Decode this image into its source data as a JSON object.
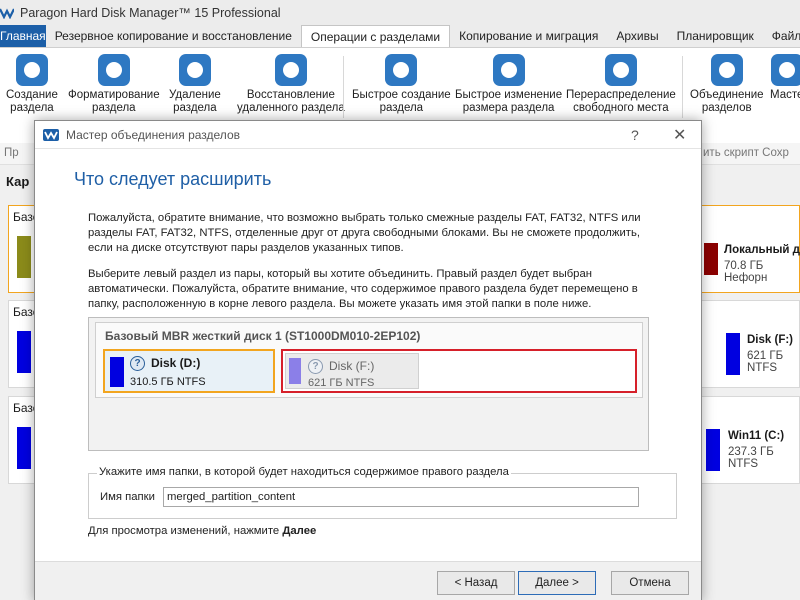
{
  "app": {
    "title": "Paragon Hard Disk Manager™ 15 Professional"
  },
  "tabs": [
    {
      "label": "Главная"
    },
    {
      "label": "Резервное копирование и восстановление"
    },
    {
      "label": "Операции с разделами"
    },
    {
      "label": "Копирование и миграция"
    },
    {
      "label": "Архивы"
    },
    {
      "label": "Планировщик"
    },
    {
      "label": "Файловы"
    }
  ],
  "ribbon": {
    "buttons": [
      {
        "line1": "Создание",
        "line2": "раздела",
        "icon": "create-partition-icon"
      },
      {
        "line1": "Форматирование",
        "line2": "раздела",
        "icon": "format-partition-icon"
      },
      {
        "line1": "Удаление",
        "line2": "раздела",
        "icon": "delete-partition-icon"
      },
      {
        "line1": "Восстановление",
        "line2": "удаленного раздела",
        "icon": "recover-partition-icon"
      },
      {
        "line1": "Быстрое создание",
        "line2": "раздела",
        "icon": "quick-create-icon"
      },
      {
        "line1": "Быстрое изменение",
        "line2": "размера раздела",
        "icon": "quick-resize-icon"
      },
      {
        "line1": "Перераспределение",
        "line2": "свободного места",
        "icon": "redistribute-icon"
      },
      {
        "line1": "Объединение",
        "line2": "разделов",
        "icon": "merge-partitions-icon"
      },
      {
        "line1": "Масте",
        "line2": "",
        "icon": "wizard-icon"
      }
    ]
  },
  "toolbar2": {
    "left": "Пр",
    "right": "ить скрипт  Сохр"
  },
  "background": {
    "map_label": "Кар",
    "disk_labels": [
      "Базо",
      "Базо",
      "Базо"
    ],
    "partitions": [
      {
        "name": "Локальный д",
        "size": "70.8 ГБ Нефорн",
        "color": "#8b0000"
      },
      {
        "name": "Disk (F:)",
        "size": "621 ГБ NTFS",
        "color": "#0000e0"
      },
      {
        "name": "Win11 (C:)",
        "size": "237.3 ГБ NTFS",
        "color": "#0000e0"
      }
    ]
  },
  "dialog": {
    "title": "Мастер объединения разделов",
    "help": "?",
    "close": "✕",
    "heading": "Что следует расширить",
    "para1": [
      "Пожалуйста, обратите внимание, что возможно выбрать только смежные разделы FAT, FAT32, NTFS или",
      "разделы FAT, FAT32, NTFS, отделенные друг от друга свободными блоками. Вы не сможете продолжить,",
      "если на диске отсутствуют пары разделов указанных типов."
    ],
    "para2": [
      "Выберите левый раздел из пары, который вы хотите объединить. Правый раздел будет выбран",
      "автоматически. Пожалуйста, обратите внимание, что содержимое правого раздела будет перемещено в",
      "папку, расположенную в корне левого раздела. Вы можете указать имя этой папки в поле ниже."
    ],
    "disk": {
      "name": "Базовый MBR жесткий диск 1 (ST1000DM010-2EP102)",
      "left": {
        "name": "Disk (D:)",
        "size": "310.5 ГБ NTFS",
        "color": "#0000e0"
      },
      "right": {
        "name": "Disk (F:)",
        "size": "621 ГБ NTFS",
        "color": "#8b7fe8"
      }
    },
    "folder_group": {
      "title": "Укажите имя папки, в которой будет находиться содержимое правого раздела",
      "label": "Имя папки",
      "value": "merged_partition_content"
    },
    "hint_prefix": "Для просмотра изменений, нажмите ",
    "hint_bold": "Далее",
    "buttons": {
      "back": "< Назад",
      "next": "Далее >",
      "cancel": "Отмена"
    }
  },
  "colors": {
    "accent": "#1c5fa8",
    "heading": "#1f5fa6",
    "selected_border": "#f2a51f",
    "pair_border": "#d6202a"
  }
}
